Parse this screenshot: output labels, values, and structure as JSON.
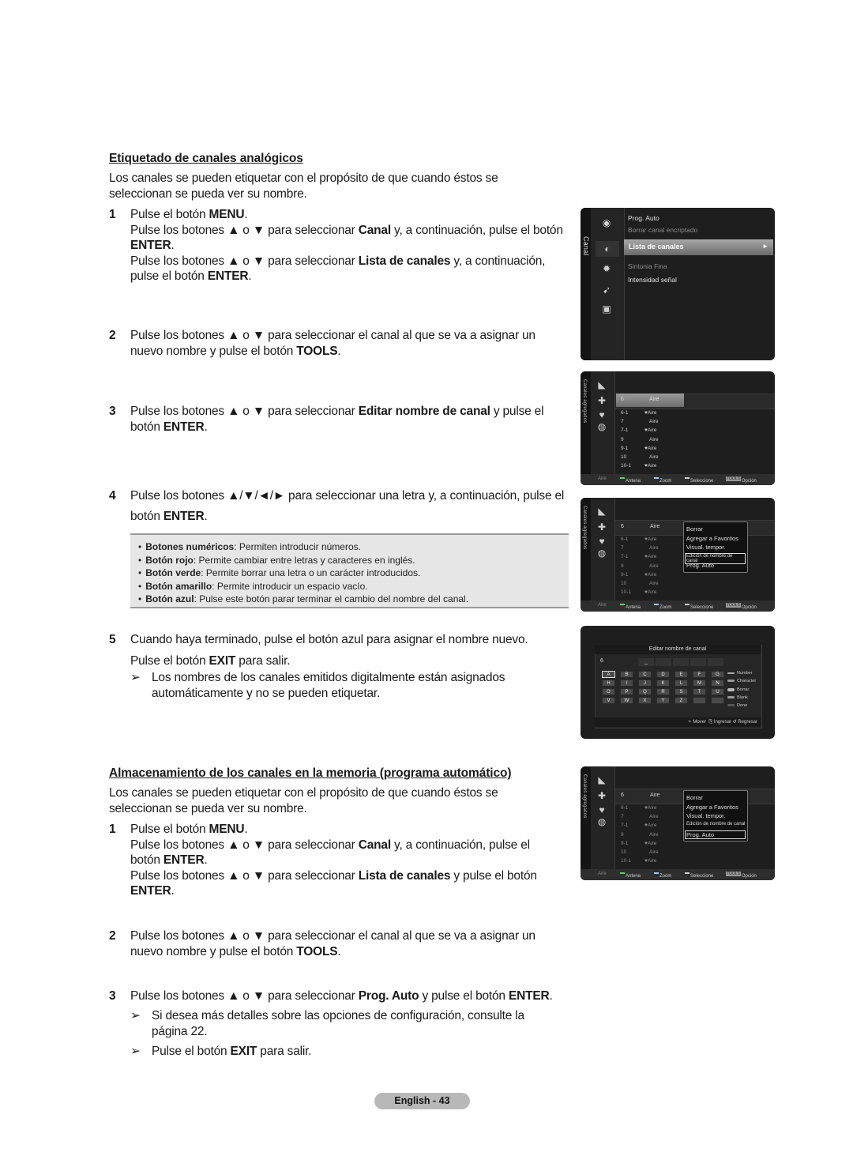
{
  "section1": {
    "heading": "Etiquetado de canales analógicos",
    "intro": "Los canales se pueden etiquetar con el propósito de que cuando éstos se seleccionan se pueda ver su nombre.",
    "steps": [
      {
        "num": "1",
        "lines": [
          [
            "Pulse el botón ",
            {
              "b": "MENU"
            },
            "."
          ],
          [
            "Pulse los botones ▲ o ▼ para seleccionar ",
            {
              "b": "Canal"
            },
            " y, a continuación, pulse el botón ",
            {
              "b": "ENTER"
            },
            "."
          ],
          [
            "Pulse los botones ▲ o ▼ para seleccionar ",
            {
              "b": "Lista de canales"
            },
            " y, a continuación, pulse el botón ",
            {
              "b": "ENTER"
            },
            "."
          ]
        ]
      },
      {
        "num": "2",
        "lines": [
          [
            "Pulse los botones ▲ o ▼ para seleccionar el canal al que se va a asignar un nuevo nombre y pulse el botón ",
            {
              "b": "TOOLS"
            },
            "."
          ]
        ]
      },
      {
        "num": "3",
        "lines": [
          [
            "Pulse los botones ▲ o ▼ para seleccionar ",
            {
              "b": "Editar nombre de canal"
            },
            " y pulse el botón ",
            {
              "b": "ENTER"
            },
            "."
          ]
        ]
      },
      {
        "num": "4",
        "lines": [
          [
            "Pulse los botones ▲/▼/◄/► para seleccionar una letra y, a continuación, pulse el botón ",
            {
              "b": "ENTER"
            },
            "."
          ]
        ]
      },
      {
        "num": "5",
        "lines": [
          [
            "Cuando haya terminado, pulse el botón azul para asignar el nombre nuevo."
          ],
          [
            "Pulse el botón ",
            {
              "b": "EXIT"
            },
            " para salir."
          ]
        ]
      }
    ],
    "bullets": [
      {
        "label": "Botones numéricos",
        "text": ": Permiten introducir números."
      },
      {
        "label": "Botón rojo",
        "text": ": Permite cambiar entre letras y caracteres en inglés."
      },
      {
        "label": "Botón verde",
        "text": ": Permite borrar una letra o un carácter introducidos."
      },
      {
        "label": "Botón amarillo",
        "text": ": Permite introducir un espacio vacío."
      },
      {
        "label": "Botón azul",
        "text": ": Pulse este botón parar terminar el cambio del nombre del canal."
      }
    ],
    "note": "Los nombres de los canales emitidos digitalmente están asignados automáticamente y no se pueden etiquetar."
  },
  "section2": {
    "heading": "Almacenamiento de los canales en la memoria (programa automático)",
    "intro": "Los canales se pueden etiquetar con el propósito de que cuando éstos se seleccionan se pueda ver su nombre.",
    "steps": [
      {
        "num": "1",
        "lines": [
          [
            "Pulse el botón ",
            {
              "b": "MENU"
            },
            "."
          ],
          [
            "Pulse los botones ▲ o ▼ para seleccionar ",
            {
              "b": "Canal"
            },
            " y, a continuación, pulse el botón ",
            {
              "b": "ENTER"
            },
            "."
          ],
          [
            "Pulse los botones ▲ o ▼ para seleccionar ",
            {
              "b": "Lista de canales"
            },
            " y pulse el botón ",
            {
              "b": "ENTER"
            },
            "."
          ]
        ]
      },
      {
        "num": "2",
        "lines": [
          [
            "Pulse los botones ▲ o ▼ para seleccionar el canal al que se va a asignar un nuevo nombre y pulse el botón ",
            {
              "b": "TOOLS"
            },
            "."
          ]
        ]
      },
      {
        "num": "3",
        "lines": [
          [
            "Pulse los botones ▲ o ▼ para seleccionar ",
            {
              "b": "Prog. Auto"
            },
            " y pulse el botón ",
            {
              "b": "ENTER"
            },
            "."
          ]
        ]
      }
    ],
    "notes": [
      "Si desea más detalles sobre las opciones de configuración, consulte la página 22.",
      "Pulse el botón EXIT para salir."
    ]
  },
  "note_arrow": "➢",
  "tv_menu": {
    "side_label": "Canal",
    "items": [
      {
        "label": "Prog. Auto",
        "state": "normal"
      },
      {
        "label": "Borrar canal encriptado",
        "state": "dim"
      },
      {
        "label": "Lista de canales",
        "state": "selected"
      },
      {
        "label": "Sintonia Fina",
        "state": "dim"
      },
      {
        "label": "Intensidad señal",
        "state": "normal"
      }
    ],
    "arrow": "►"
  },
  "tv_list": {
    "side_label": "Canales agregados",
    "selected": {
      "ch": "6",
      "type": "Aire"
    },
    "rows": [
      {
        "ch": "6-1",
        "type": "♥Aire"
      },
      {
        "ch": "7",
        "type": "Aire"
      },
      {
        "ch": "7-1",
        "type": "♥Aire"
      },
      {
        "ch": "9",
        "type": "Aire"
      },
      {
        "ch": "9-1",
        "type": "♥Aire"
      },
      {
        "ch": "10",
        "type": "Aire"
      },
      {
        "ch": "10-1",
        "type": "♥Aire"
      }
    ],
    "footer": {
      "source": "Aire",
      "antena": "Antena",
      "zoom": "Zoom",
      "select": "Seleccione",
      "tools": "TOOLS",
      "option": "Opción"
    }
  },
  "tools_popup": {
    "items": [
      "Borrar",
      "Agregar a Favoritos",
      "Visual. tempor.",
      "Edición de nombre de canal",
      "Prog. Auto"
    ],
    "highlight_screen3": 3,
    "highlight_screen5": 4
  },
  "keyboard": {
    "title": "Editar nombre de canal",
    "channel": "6",
    "cursor": "_",
    "keys": [
      "A",
      "B",
      "C",
      "D",
      "E",
      "F",
      "G",
      "H",
      "I",
      "J",
      "K",
      "L",
      "M",
      "N",
      "O",
      "P",
      "Q",
      "R",
      "S",
      "T",
      "U",
      "V",
      "W",
      "X",
      "Y",
      "Z",
      "",
      ""
    ],
    "active_key": "A",
    "legend": [
      "Number",
      "Character",
      "Borrar",
      "Blank",
      "Done"
    ],
    "footer": {
      "move": "Mover",
      "enter": "Ingresar",
      "back": "Regresar"
    }
  },
  "page": {
    "label": "English - 43"
  }
}
